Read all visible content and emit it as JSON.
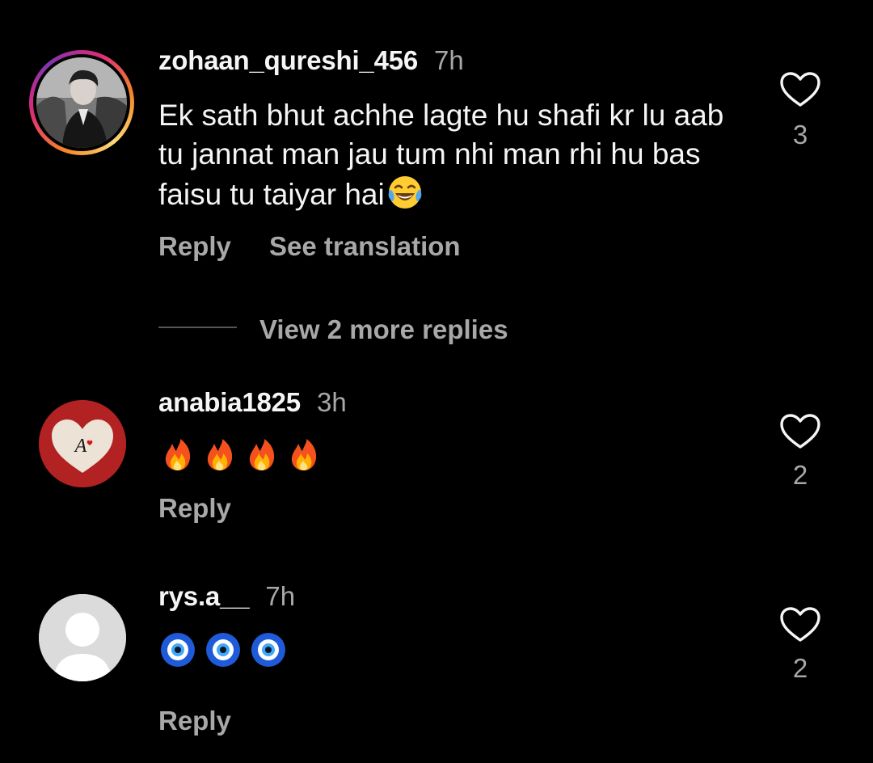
{
  "comments": [
    {
      "username": "zohaan_qureshi_456",
      "time": "7h",
      "text": "Ek sath bhut achhe lagte hu shafi kr lu aab tu jannat man jau tum nhi man rhi hu bas faisu tu taiyar hai",
      "text_emoji": "laughing-tears-emoji",
      "likes": "3",
      "reply_label": "Reply",
      "translate_label": "See translation",
      "avatar": "profile-photo-with-story-ring"
    },
    {
      "username": "anabia1825",
      "time": "3h",
      "emojis": [
        "fire-emoji",
        "fire-emoji",
        "fire-emoji",
        "fire-emoji"
      ],
      "likes": "2",
      "reply_label": "Reply",
      "avatar": "red-heart-letter-a"
    },
    {
      "username": "rys.a__",
      "time": "7h",
      "emojis": [
        "nazar-amulet-emoji",
        "nazar-amulet-emoji",
        "nazar-amulet-emoji"
      ],
      "likes": "2",
      "reply_label": "Reply",
      "avatar": "default-avatar"
    }
  ],
  "view_replies_label": "View 2 more replies",
  "avatar_letter": "A",
  "icons": {
    "like": "heart-outline-icon"
  },
  "colors": {
    "background": "#000000",
    "primary_text": "#f5f5f5",
    "secondary_text": "#a8a8a8"
  }
}
